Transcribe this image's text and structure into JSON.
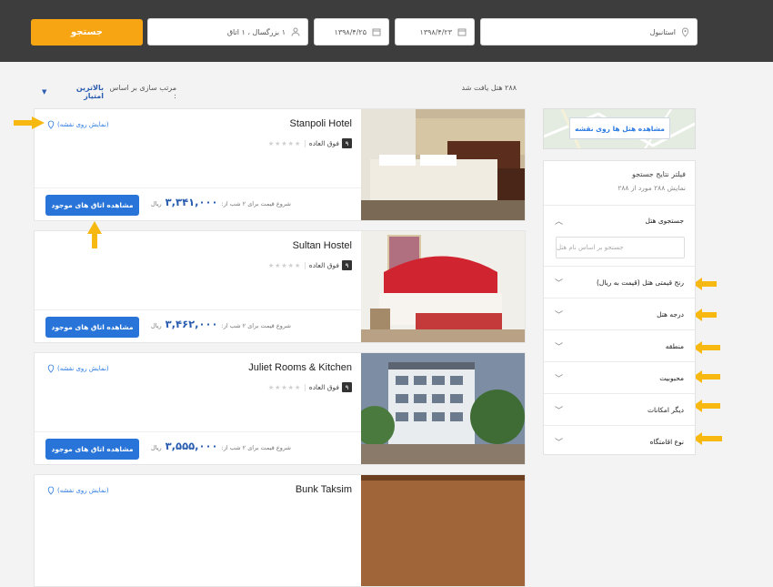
{
  "search": {
    "destination": "استانبول",
    "checkin": "۱۳۹۸/۴/۲۳",
    "checkout": "۱۳۹۸/۴/۲۵",
    "guests": "۱ بزرگسال ، ۱ اتاق",
    "button": "جستجو"
  },
  "results": {
    "count_text": "۲۸۸ هتل یافت شد",
    "sort_label": "مرتب سازی بر اساس :",
    "sort_value": "بالاترین امتیاز"
  },
  "hotels": [
    {
      "name": "Stanpoli Hotel",
      "map_link": "(نمایش روی نقشه)",
      "score": "۹",
      "score_label": "فوق العاده",
      "price_label": "شروع قیمت برای ۲ شب از:",
      "price": "۳,۳۴۱,۰۰۰",
      "currency": "ریال",
      "button": "مشاهده اتاق های موجود"
    },
    {
      "name": "Sultan Hostel",
      "map_link": "",
      "score": "۹",
      "score_label": "فوق العاده",
      "price_label": "شروع قیمت برای ۲ شب از:",
      "price": "۳,۴۶۲,۰۰۰",
      "currency": "ریال",
      "button": "مشاهده اتاق های موجود"
    },
    {
      "name": "Juliet Rooms & Kitchen",
      "map_link": "(نمایش روی نقشه)",
      "score": "۹",
      "score_label": "فوق العاده",
      "price_label": "شروع قیمت برای ۲ شب از:",
      "price": "۳,۵۵۵,۰۰۰",
      "currency": "ریال",
      "button": "مشاهده اتاق های موجود"
    },
    {
      "name": "Bunk Taksim",
      "map_link": "(نمایش روی نقشه)"
    }
  ],
  "sidebar": {
    "map_button": "مشاهده هتل ها روی نقشه",
    "filter_title": "فیلتر نتایج جستجو",
    "filter_sub": "نمایش ۲۸۸ مورد از ۲۸۸",
    "hotel_search_title": "جستجوی هتل",
    "hotel_search_placeholder": "جستجو بر اساس نام هتل",
    "sections": [
      "رنج قیمتی هتل (قیمت به ریال)",
      "درجه هتل",
      "منطقه",
      "محبوبیت",
      "دیگر امکانات",
      "نوع اقامتگاه"
    ]
  },
  "colors": {
    "accent": "#f7a512",
    "primary": "#2874d8",
    "header": "#3d3d3d"
  }
}
